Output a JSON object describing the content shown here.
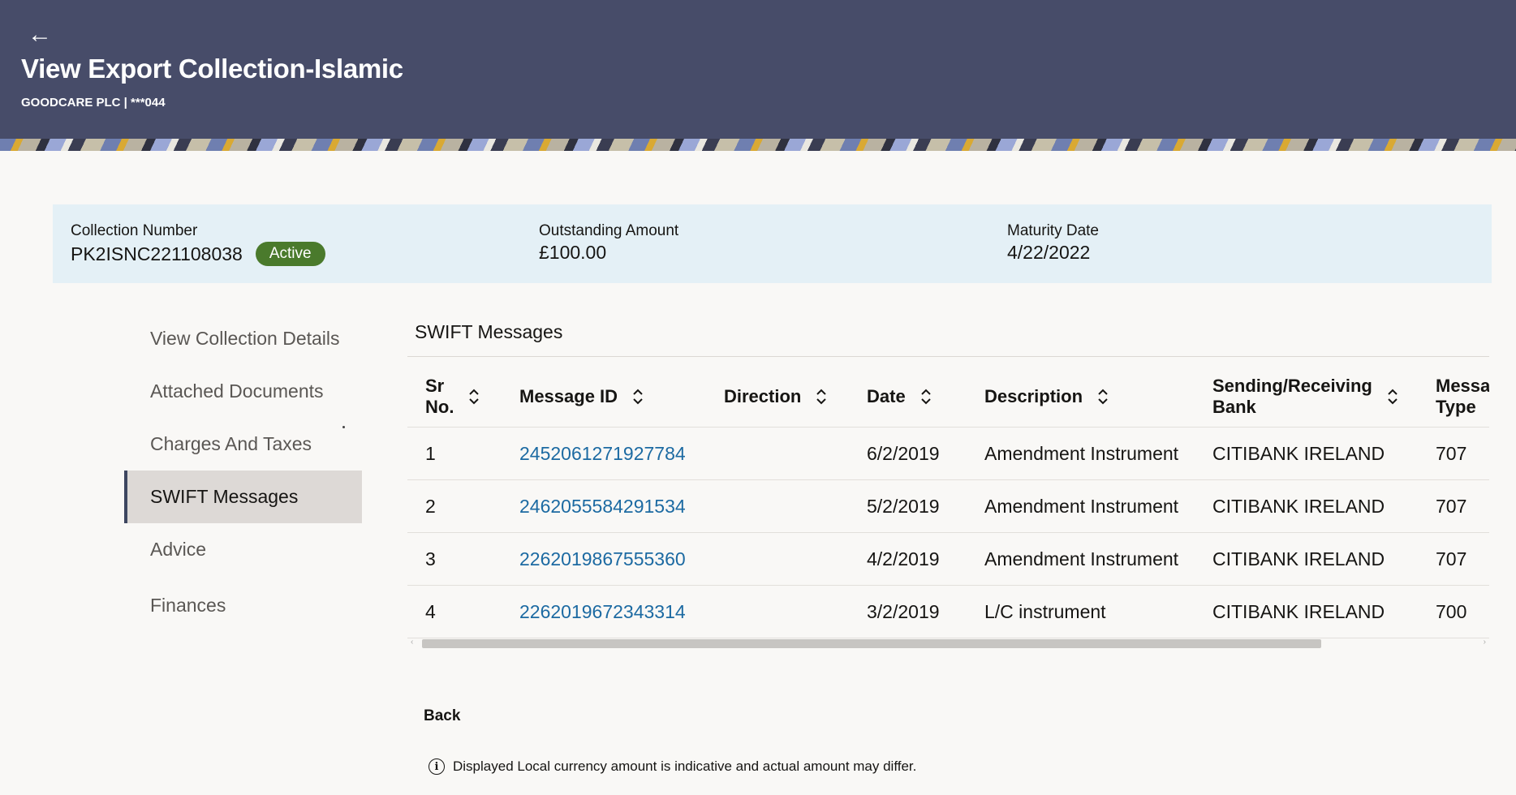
{
  "header": {
    "back_icon": "←",
    "title": "View Export Collection-Islamic",
    "subtitle": "GOODCARE PLC | ***044"
  },
  "summary": {
    "collection_number_label": "Collection Number",
    "collection_number": "PK2ISNC221108038",
    "status": "Active",
    "outstanding_amount_label": "Outstanding Amount",
    "outstanding_amount": "£100.00",
    "maturity_date_label": "Maturity Date",
    "maturity_date": "4/22/2022"
  },
  "nav": {
    "items": [
      {
        "label": "View Collection Details"
      },
      {
        "label": "Attached Documents"
      },
      {
        "label": "Charges And Taxes"
      },
      {
        "label": "SWIFT Messages"
      },
      {
        "label": "Advice"
      },
      {
        "label": "Finances"
      }
    ],
    "active_index": 3
  },
  "swift": {
    "section_title": "SWIFT Messages",
    "columns": {
      "sr_no_1": "Sr",
      "sr_no_2": "No.",
      "message_id": "Message ID",
      "direction": "Direction",
      "date": "Date",
      "description": "Description",
      "bank_1": "Sending/Receiving",
      "bank_2": "Bank",
      "type_1": "Messa",
      "type_2": "Type"
    },
    "rows": [
      {
        "sr": "1",
        "message_id": "2452061271927784",
        "direction": "",
        "date": "6/2/2019",
        "description": "Amendment Instrument",
        "bank": "CITIBANK IRELAND",
        "type": "707"
      },
      {
        "sr": "2",
        "message_id": "2462055584291534",
        "direction": "",
        "date": "5/2/2019",
        "description": "Amendment Instrument",
        "bank": "CITIBANK IRELAND",
        "type": "707"
      },
      {
        "sr": "3",
        "message_id": "2262019867555360",
        "direction": "",
        "date": "4/2/2019",
        "description": "Amendment Instrument",
        "bank": "CITIBANK IRELAND",
        "type": "707"
      },
      {
        "sr": "4",
        "message_id": "2262019672343314",
        "direction": "",
        "date": "3/2/2019",
        "description": "L/C instrument",
        "bank": "CITIBANK IRELAND",
        "type": "700"
      }
    ]
  },
  "footer": {
    "back_label": "Back",
    "info_icon": "i",
    "info_text": "Displayed Local currency amount is indicative and actual amount may differ."
  },
  "colors": {
    "header_bg": "#474c69",
    "summary_bg": "#e4f0f6",
    "status_badge": "#4a7a2c",
    "link": "#1c6aa2"
  }
}
